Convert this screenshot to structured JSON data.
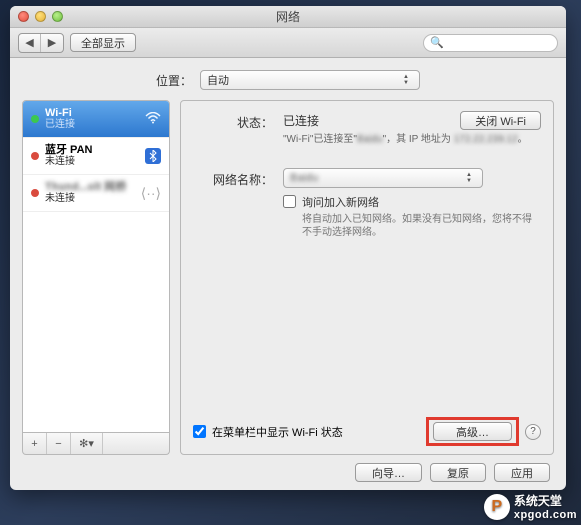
{
  "window": {
    "title": "网络"
  },
  "toolbar": {
    "back_icon": "◀",
    "fwd_icon": "▶",
    "show_all_label": "全部显示",
    "search_placeholder": "",
    "search_icon": "🔍"
  },
  "location": {
    "label": "位置：",
    "selected": "自动"
  },
  "sidebar": {
    "items": [
      {
        "name": "Wi-Fi",
        "status": "已连接",
        "dot": "green",
        "icon": "wifi"
      },
      {
        "name": "蓝牙 PAN",
        "status": "未连接",
        "dot": "red",
        "icon": "bluetooth"
      },
      {
        "name": "Thund...olt 网桥",
        "status": "未连接",
        "dot": "red",
        "icon": "link"
      }
    ],
    "footer": {
      "add": "+",
      "remove": "−",
      "gear": "✻▾"
    }
  },
  "detail": {
    "status_label": "状态：",
    "status_value": "已连接",
    "turn_off_label": "关闭 Wi-Fi",
    "substatus_prefix": "\"Wi-Fi\"已连接至\"",
    "substatus_ssid": "Baidu",
    "substatus_mid": "\"，其 IP 地址为 ",
    "substatus_ip": "172.22.239.12",
    "substatus_suffix": "。",
    "network_label": "网络名称：",
    "network_selected": "Baidu",
    "ask_join_label": "询问加入新网络",
    "ask_join_hint": "将自动加入已知网络。如果没有已知网络，您将不得不手动选择网络。",
    "menubar_label": "在菜单栏中显示 Wi-Fi 状态",
    "advanced_label": "高级…",
    "help_icon": "?"
  },
  "buttons": {
    "assist": "向导…",
    "revert": "复原",
    "apply": "应用"
  },
  "watermark": {
    "cn": "系统天堂",
    "en": "xpgod.com",
    "logo": "P"
  }
}
